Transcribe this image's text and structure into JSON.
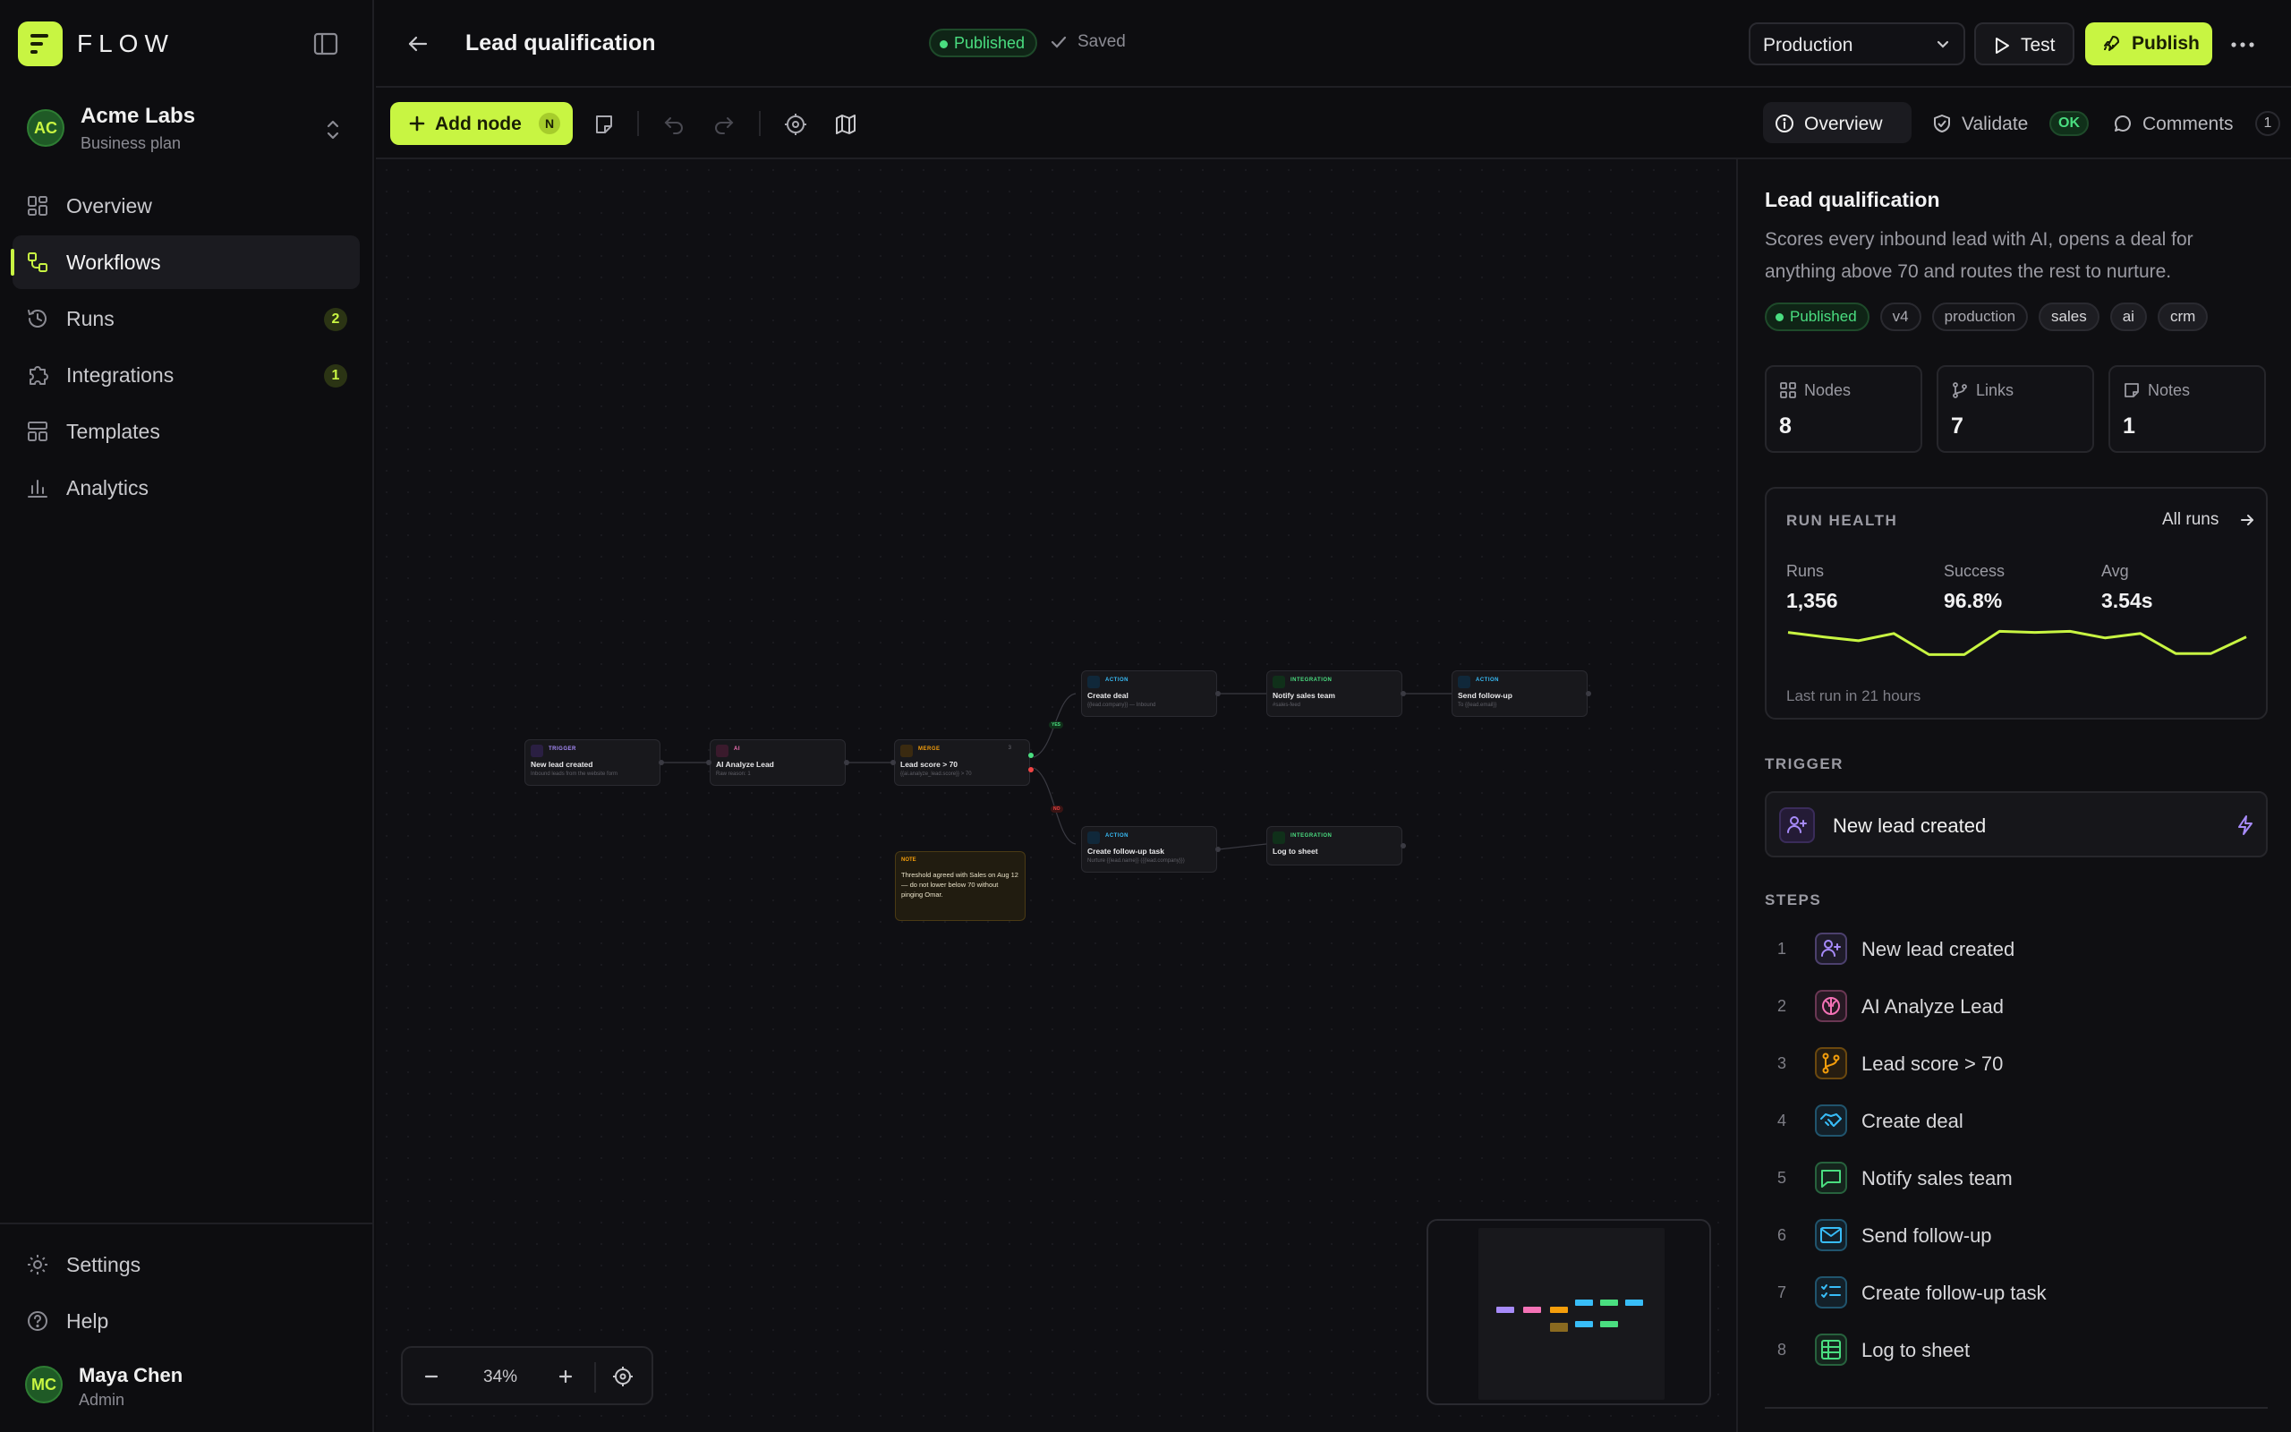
{
  "app": {
    "logo_text": "FLOW"
  },
  "org": {
    "initials": "AC",
    "name": "Acme Labs",
    "plan": "Business plan"
  },
  "nav": [
    {
      "label": "Overview",
      "badge": ""
    },
    {
      "label": "Workflows",
      "badge": ""
    },
    {
      "label": "Runs",
      "badge": "2"
    },
    {
      "label": "Integrations",
      "badge": "1"
    },
    {
      "label": "Templates",
      "badge": ""
    },
    {
      "label": "Analytics",
      "badge": ""
    }
  ],
  "nav_bottom": [
    {
      "label": "Settings"
    },
    {
      "label": "Help"
    }
  ],
  "user": {
    "initials": "MC",
    "name": "Maya Chen",
    "role": "Admin"
  },
  "header": {
    "title": "Lead qualification",
    "status": "Published",
    "saved": "Saved",
    "environment": "Production",
    "test_label": "Test",
    "publish_label": "Publish"
  },
  "toolbar": {
    "add_node_label": "Add node",
    "add_node_shortcut": "N",
    "tabs": {
      "overview": "Overview",
      "validate": "Validate",
      "validate_status": "OK",
      "comments": "Comments",
      "comments_count": "1"
    }
  },
  "canvas": {
    "zoom": "34%",
    "nodes": [
      {
        "type": "TRIGGER",
        "title": "New lead created",
        "subtitle": "Inbound leads from the website form"
      },
      {
        "type": "AI",
        "title": "AI Analyze Lead",
        "subtitle": "Raw reason: 1"
      },
      {
        "type": "MERGE",
        "title": "Lead score > 70",
        "subtitle": "{{ai.analyze_lead.score}} > 70",
        "count": "3"
      },
      {
        "type": "ACTION",
        "title": "Create deal",
        "subtitle": "{{lead.company}} — Inbound"
      },
      {
        "type": "INTEGRATION",
        "title": "Notify sales team",
        "subtitle": "#sales-feed"
      },
      {
        "type": "ACTION",
        "title": "Send follow-up",
        "subtitle": "To {{lead.email}}"
      },
      {
        "type": "ACTION",
        "title": "Create follow-up task",
        "subtitle": "Nurture {{lead.name}} ({{lead.company}})"
      },
      {
        "type": "INTEGRATION",
        "title": "Log to sheet",
        "subtitle": ""
      }
    ],
    "note": {
      "type": "NOTE",
      "text": "Threshold agreed with Sales on Aug 12 — do not lower below 70 without pinging Omar."
    },
    "edge_labels": {
      "yes": "YES",
      "no": "NO"
    }
  },
  "panel": {
    "title": "Lead qualification",
    "description": "Scores every inbound lead with AI, opens a deal for anything above 70 and routes the rest to nurture.",
    "tags": [
      "Published",
      "v4",
      "production",
      "sales",
      "ai",
      "crm"
    ],
    "stats": [
      {
        "label": "Nodes",
        "value": "8"
      },
      {
        "label": "Links",
        "value": "7"
      },
      {
        "label": "Notes",
        "value": "1"
      }
    ],
    "health": {
      "title": "RUN HEALTH",
      "link": "All runs",
      "runs_label": "Runs",
      "runs": "1,356",
      "success_label": "Success",
      "success": "96.8%",
      "avg_label": "Avg",
      "avg": "3.54s",
      "footer": "Last run in 21 hours",
      "sparkline": [
        0.7,
        0.62,
        0.55,
        0.68,
        0.3,
        0.3,
        0.72,
        0.7,
        0.72,
        0.6,
        0.68,
        0.32,
        0.32,
        0.62
      ]
    },
    "trigger_heading": "TRIGGER",
    "trigger": "New lead created",
    "steps_heading": "STEPS",
    "steps": [
      {
        "num": "1",
        "label": "New lead created",
        "icon": "user-plus-icon",
        "color": "#a78bfa"
      },
      {
        "num": "2",
        "label": "AI Analyze Lead",
        "icon": "brain-icon",
        "color": "#f472b6"
      },
      {
        "num": "3",
        "label": "Lead score > 70",
        "icon": "branch-icon",
        "color": "#f59e0b"
      },
      {
        "num": "4",
        "label": "Create deal",
        "icon": "handshake-icon",
        "color": "#38bdf8"
      },
      {
        "num": "5",
        "label": "Notify sales team",
        "icon": "message-icon",
        "color": "#4ade80"
      },
      {
        "num": "6",
        "label": "Send follow-up",
        "icon": "mail-icon",
        "color": "#38bdf8"
      },
      {
        "num": "7",
        "label": "Create follow-up task",
        "icon": "checklist-icon",
        "color": "#38bdf8"
      },
      {
        "num": "8",
        "label": "Log to sheet",
        "icon": "table-icon",
        "color": "#4ade80"
      }
    ]
  },
  "colors": {
    "accent": "#c8f542",
    "success": "#4ade80",
    "trigger": "#a78bfa",
    "ai": "#f472b6",
    "merge": "#f59e0b",
    "action": "#38bdf8",
    "integration": "#4ade80"
  }
}
